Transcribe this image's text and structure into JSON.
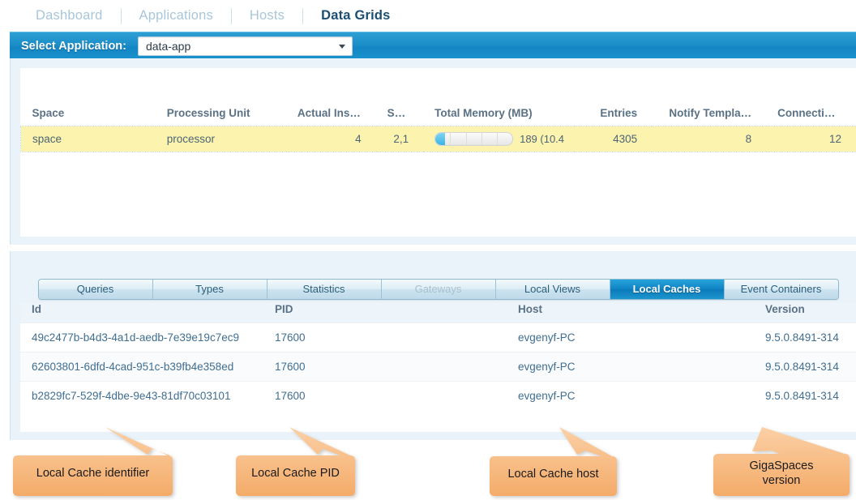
{
  "nav": {
    "items": [
      {
        "label": "Dashboard",
        "active": false
      },
      {
        "label": "Applications",
        "active": false
      },
      {
        "label": "Hosts",
        "active": false
      },
      {
        "label": "Data Grids",
        "active": true
      }
    ]
  },
  "appbar": {
    "label": "Select Application:",
    "selected": "data-app",
    "dropdown_icon": "chevron-down-icon"
  },
  "space_grid": {
    "headers": [
      "Space",
      "Processing Unit",
      "Actual Instan…",
      "SLA",
      "Total Memory (MB)",
      "Entries",
      "Notify Templa…",
      "Connections"
    ],
    "row": {
      "space": "space",
      "processing_unit": "processor",
      "actual_instances": "4",
      "sla": "2,1",
      "memory_text": "189 (10.4",
      "memory_percent": 13,
      "entries": "4305",
      "notify_templates": "8",
      "connections": "12"
    }
  },
  "tabs": [
    {
      "label": "Queries",
      "state": "normal"
    },
    {
      "label": "Types",
      "state": "normal"
    },
    {
      "label": "Statistics",
      "state": "normal"
    },
    {
      "label": "Gateways",
      "state": "disabled"
    },
    {
      "label": "Local Views",
      "state": "normal"
    },
    {
      "label": "Local Caches",
      "state": "active"
    },
    {
      "label": "Event Containers",
      "state": "normal"
    }
  ],
  "detail_grid": {
    "headers": [
      "Id",
      "PID",
      "Host",
      "Version"
    ],
    "rows": [
      {
        "id": "49c2477b-b4d3-4a1d-aedb-7e39e19c7ec9",
        "pid": "17600",
        "host": "evgenyf-PC",
        "version": "9.5.0.8491-314"
      },
      {
        "id": "62603801-6dfd-4cad-951c-b39fb4e358ed",
        "pid": "17600",
        "host": "evgenyf-PC",
        "version": "9.5.0.8491-314"
      },
      {
        "id": "b2829fc7-529f-4dbe-9e43-81df70c03101",
        "pid": "17600",
        "host": "evgenyf-PC",
        "version": "9.5.0.8491-314"
      }
    ]
  },
  "callouts": [
    {
      "text": "Local Cache identifier"
    },
    {
      "text": "Local Cache PID"
    },
    {
      "text": "Local Cache host"
    },
    {
      "text": "GigaSpaces\nversion"
    }
  ],
  "colors": {
    "accent_blue": "#1385c4",
    "callout_fill": "#f7bc82",
    "selected_row": "#fbf3ae",
    "link_text": "#3f6e92"
  }
}
